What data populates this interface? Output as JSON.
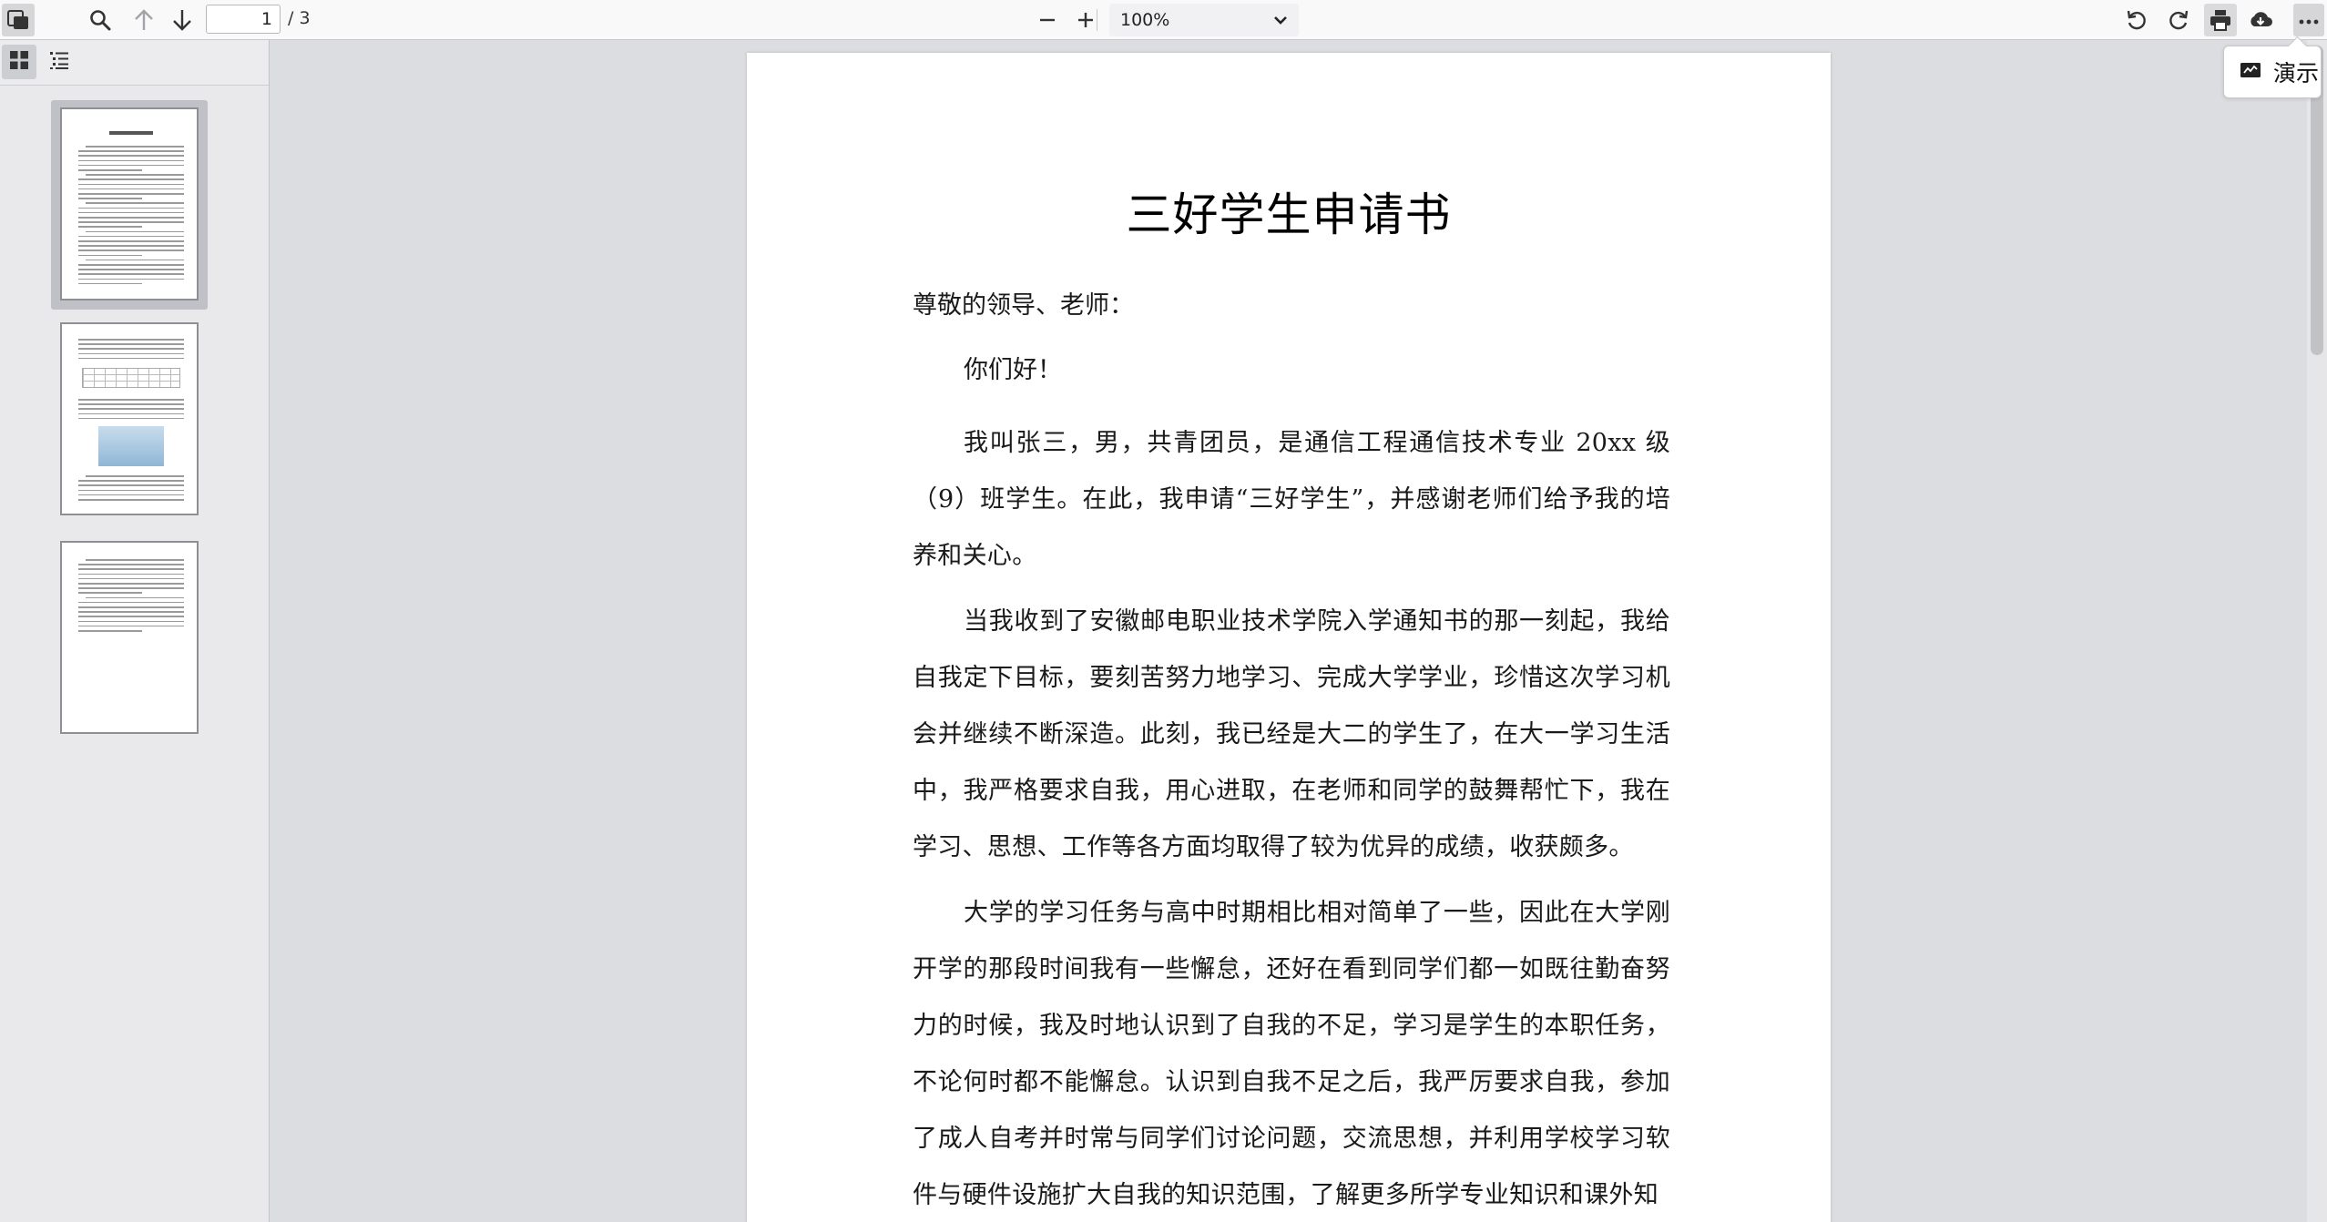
{
  "toolbar": {
    "page_current": "1",
    "page_total": "/ 3",
    "zoom_value": "100%"
  },
  "popup": {
    "present_label": "演示"
  },
  "document": {
    "title": "三好学生申请书",
    "salutation": "尊敬的领导、老师：",
    "greeting": "你们好！",
    "paragraphs": [
      "我叫张三，男，共青团员，是通信工程通信技术专业 20xx 级（9）班学生。在此，我申请“三好学生”，并感谢老师们给予我的培养和关心。",
      "当我收到了安徽邮电职业技术学院入学通知书的那一刻起，我给自我定下目标，要刻苦努力地学习、完成大学学业，珍惜这次学习机会并继续不断深造。此刻，我已经是大二的学生了，在大一学习生活中，我严格要求自我，用心进取，在老师和同学的鼓舞帮忙下，我在学习、思想、工作等各方面均取得了较为优异的成绩，收获颇多。",
      "大学的学习任务与高中时期相比相对简单了一些，因此在大学刚开学的那段时间我有一些懈怠，还好在看到同学们都一如既往勤奋努力的时候，我及时地认识到了自我的不足，学习是学生的本职任务，不论何时都不能懈怠。认识到自我不足之后，我严厉要求自我，参加了成人自考并时常与同学们讨论问题，交流思想，并利用学校学习软件与硬件设施扩大自我的知识范围，了解更多所学专业知识和课外知"
    ]
  },
  "colors": {
    "toolbar_bg": "#f9f9fa",
    "sidebar_bg": "#e9e9ec",
    "viewer_bg": "#dcdde1",
    "page_bg": "#ffffff"
  }
}
